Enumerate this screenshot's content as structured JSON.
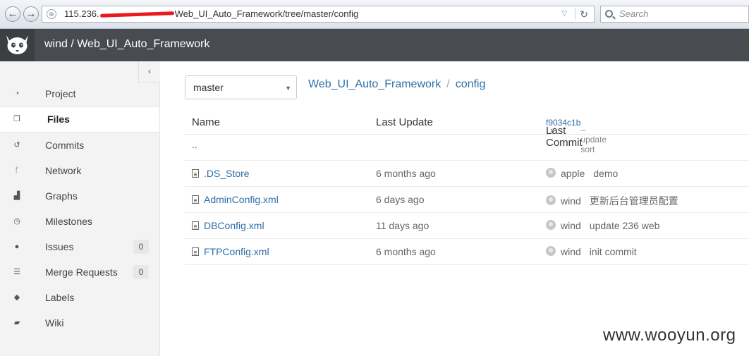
{
  "browser": {
    "url_prefix": "115.236.",
    "url_suffix": "Web_UI_Auto_Framework/tree/master/config",
    "search_placeholder": "Search",
    "back_glyph": "←",
    "forward_glyph": "→"
  },
  "header": {
    "title": "wind / Web_UI_Auto_Framework"
  },
  "sidebar": {
    "collapse_glyph": "‹",
    "items": [
      {
        "label": "Project",
        "icon": "dashboard-icon",
        "glyph": "◔",
        "count": ""
      },
      {
        "label": "Files",
        "icon": "files-icon",
        "glyph": "❐",
        "count": "",
        "active": true
      },
      {
        "label": "Commits",
        "icon": "history-icon",
        "glyph": "↺",
        "count": ""
      },
      {
        "label": "Network",
        "icon": "code-fork-icon",
        "glyph": "ᚴ",
        "count": ""
      },
      {
        "label": "Graphs",
        "icon": "area-chart-icon",
        "glyph": "▟",
        "count": ""
      },
      {
        "label": "Milestones",
        "icon": "clock-icon",
        "glyph": "◷",
        "count": ""
      },
      {
        "label": "Issues",
        "icon": "exclamation-circle-icon",
        "glyph": "●",
        "count": "0"
      },
      {
        "label": "Merge Requests",
        "icon": "tasks-icon",
        "glyph": "☰",
        "count": "0"
      },
      {
        "label": "Labels",
        "icon": "tags-icon",
        "glyph": "◆",
        "count": ""
      },
      {
        "label": "Wiki",
        "icon": "book-icon",
        "glyph": "▰",
        "count": ""
      }
    ]
  },
  "main": {
    "branch": "master",
    "breadcrumb": [
      "Web_UI_Auto_Framework",
      "config"
    ],
    "breadcrumb_separator": "/",
    "table": {
      "headers": {
        "name": "Name",
        "last_update": "Last Update",
        "last_commit": "Last Commit"
      },
      "last_commit_hash": "f9034c1b",
      "last_commit_message": "– update sort",
      "parent_dir": "..",
      "rows": [
        {
          "name": ".DS_Store",
          "updated": "6 months ago",
          "author": "apple",
          "message": "demo"
        },
        {
          "name": "AdminConfig.xml",
          "updated": "6 days ago",
          "author": "wind",
          "message": "更新后台管理员配置"
        },
        {
          "name": "DBConfig.xml",
          "updated": "11 days ago",
          "author": "wind",
          "message": "update 236 web"
        },
        {
          "name": "FTPConfig.xml",
          "updated": "6 months ago",
          "author": "wind",
          "message": "init commit"
        }
      ]
    }
  },
  "watermark": "www.wooyun.org",
  "colors": {
    "link": "#2e6ea6",
    "header_bg": "#484c51",
    "sidebar_bg": "#f3f3f3",
    "redaction": "#e8191f"
  }
}
